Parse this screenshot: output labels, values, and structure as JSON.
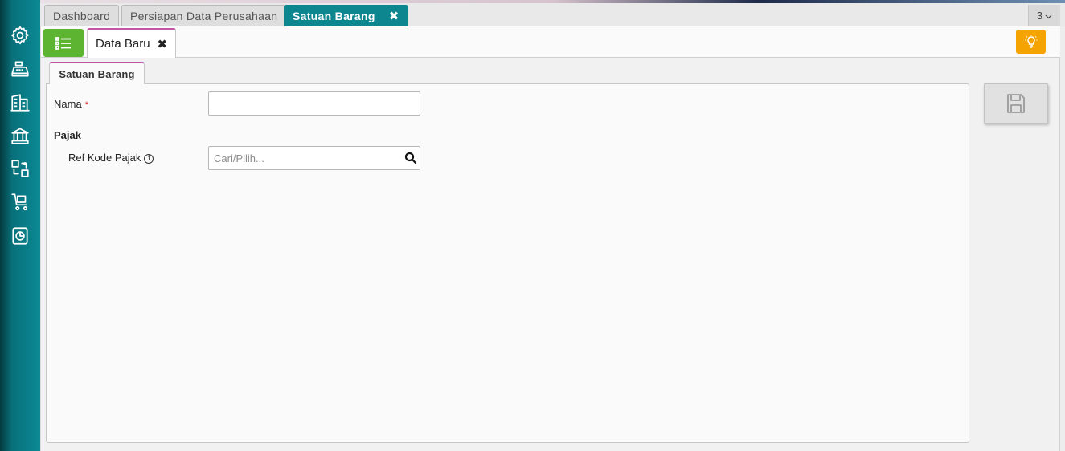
{
  "sidebar": {
    "items": [
      {
        "icon": "gear-icon"
      },
      {
        "icon": "cash-register-icon"
      },
      {
        "icon": "building-icon"
      },
      {
        "icon": "bank-icon"
      },
      {
        "icon": "process-icon"
      },
      {
        "icon": "cart-icon"
      },
      {
        "icon": "report-icon"
      }
    ]
  },
  "tabs": {
    "items": [
      {
        "label": "Dashboard"
      },
      {
        "label": "Persiapan Data Perusahaan"
      },
      {
        "label": "Satuan Barang",
        "close": "✖"
      }
    ],
    "count": "3"
  },
  "subbar": {
    "tab_label": "Data Baru",
    "tab_close": "✖"
  },
  "form": {
    "tab_label": "Satuan Barang",
    "nama_label": "Nama",
    "nama_required": "*",
    "nama_value": "",
    "section_pajak": "Pajak",
    "ref_kode_pajak_label": "Ref Kode Pajak",
    "ref_kode_pajak_info": "i",
    "ref_kode_pajak_placeholder": "Cari/Pilih..."
  },
  "colors": {
    "sidebar": "#0b8a95",
    "active_tab": "#0e8690",
    "menu_button": "#5cb431",
    "bulb_button": "#f5a300",
    "tab_accent": "#c454a5"
  }
}
